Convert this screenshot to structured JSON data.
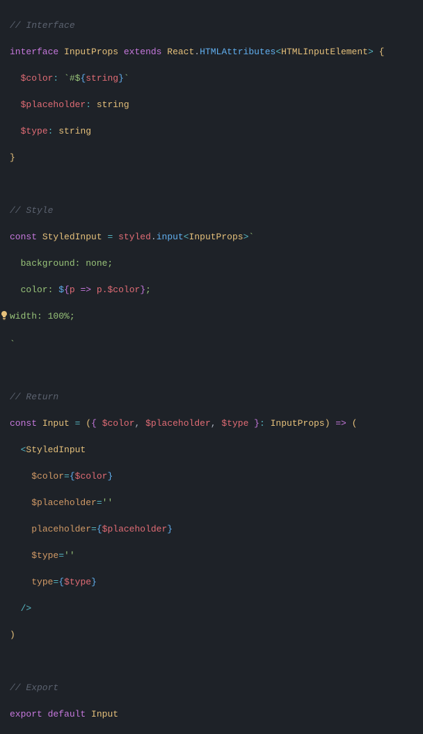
{
  "c": {
    "interface_comment": "// Interface",
    "style_comment": "// Style",
    "return_comment": "// Return",
    "export_comment": "// Export"
  },
  "kw": {
    "interface": "interface",
    "extends": "extends",
    "const": "const",
    "export": "export",
    "default": "default"
  },
  "types": {
    "InputProps": "InputProps",
    "React": "React",
    "HTMLAttributes": "HTMLAttributes",
    "HTMLInputElement": "HTMLInputElement",
    "StyledInput": "StyledInput",
    "Input": "Input"
  },
  "props": {
    "color": "$color",
    "placeholder": "$placeholder",
    "type": "$type",
    "string_type": "string",
    "string_word": "string"
  },
  "tmpl": {
    "open": "`#$",
    "brace_open": "{",
    "brace_close": "}",
    "close": "`"
  },
  "style": {
    "styled": "styled",
    "input": "input",
    "tmpl_open": "`",
    "bg_line": "  background: none;",
    "color_prefix": "  color: ",
    "dollar": "$",
    "arrow_p": "p",
    "arrow": "=>",
    "dot_color": ".$color",
    "semi": ";",
    "width_line": "width: 100%;",
    "tmpl_close": "`"
  },
  "ret": {
    "destruct_open": "({ ",
    "comma": ", ",
    "destruct_close": " }",
    "colon": ": ",
    "arrow": "=>",
    "paren_open": "(",
    "paren_close": ")"
  },
  "jsx": {
    "open_tag": "<",
    "StyledInputTag": "StyledInput",
    "color_attr": "$color",
    "eq": "=",
    "placeholder_dollar_attr": "$placeholder",
    "placeholder_attr": "placeholder",
    "type_dollar_attr": "$type",
    "type_attr": "type",
    "empty_str": "''",
    "self_close": "/>"
  }
}
